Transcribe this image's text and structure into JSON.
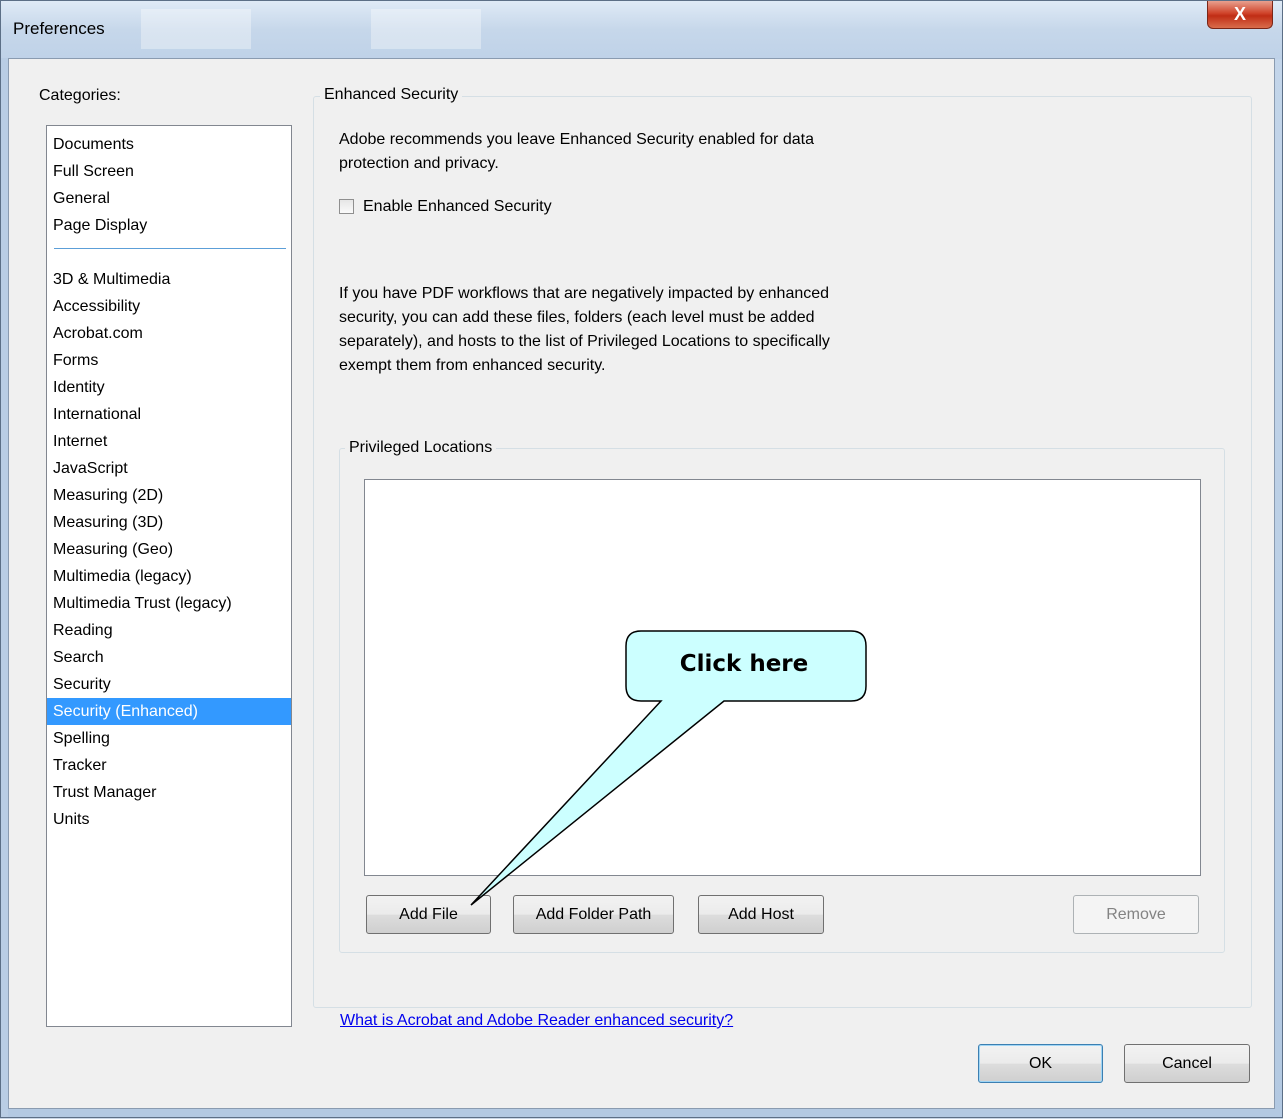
{
  "window": {
    "title": "Preferences",
    "close_glyph": "X"
  },
  "categories": {
    "label": "Categories:",
    "top_items": [
      "Documents",
      "Full Screen",
      "General",
      "Page Display"
    ],
    "items": [
      "3D & Multimedia",
      "Accessibility",
      "Acrobat.com",
      "Forms",
      "Identity",
      "International",
      "Internet",
      "JavaScript",
      "Measuring (2D)",
      "Measuring (3D)",
      "Measuring (Geo)",
      "Multimedia (legacy)",
      "Multimedia Trust (legacy)",
      "Reading",
      "Search",
      "Security",
      "Security (Enhanced)",
      "Spelling",
      "Tracker",
      "Trust Manager",
      "Units"
    ],
    "selected": "Security (Enhanced)"
  },
  "enhanced_security": {
    "group_title": "Enhanced Security",
    "recommend_text_1": "Adobe recommends you leave Enhanced Security enabled for data",
    "recommend_text_2": "protection and privacy.",
    "checkbox_label": "Enable Enhanced Security",
    "checkbox_checked": false,
    "workflow_text_1": "If you have PDF workflows that are negatively impacted by enhanced",
    "workflow_text_2": "security, you can add these files, folders (each level must be added",
    "workflow_text_3": "separately), and hosts to the list of Privileged Locations to specifically",
    "workflow_text_4": "exempt them from enhanced security."
  },
  "privileged_locations": {
    "group_title": "Privileged Locations",
    "entries": [],
    "add_file_label": "Add File",
    "add_folder_label": "Add Folder Path",
    "add_host_label": "Add Host",
    "remove_label": "Remove"
  },
  "help_link": "What is Acrobat and Adobe Reader enhanced security?",
  "footer": {
    "ok_label": "OK",
    "cancel_label": "Cancel"
  },
  "callout": {
    "text": "Click here",
    "fill_color": "#ccffff"
  },
  "colors": {
    "selection": "#3399ff",
    "link": "#0000ee",
    "close_button": "#c9432b"
  }
}
